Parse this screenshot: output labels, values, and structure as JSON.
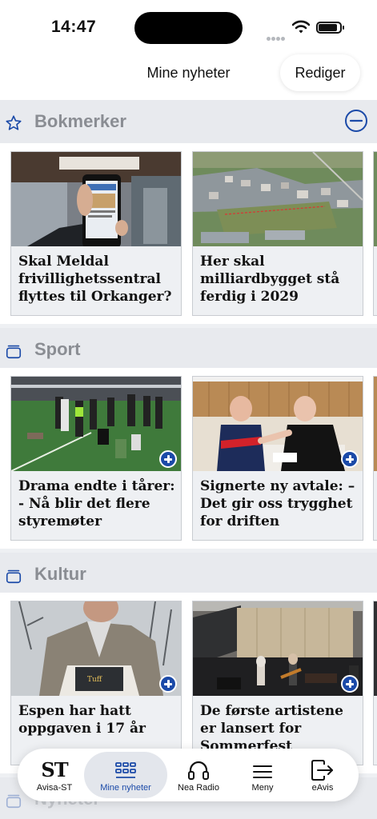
{
  "status_bar": {
    "time": "14:47"
  },
  "header": {
    "title": "Mine nyheter",
    "edit_label": "Rediger"
  },
  "sections": [
    {
      "title": "Bokmerker",
      "icon": "star-icon",
      "articles": [
        {
          "title": "Skal Meldal frivillighetssentral flyttes til Orkanger?",
          "image": "phone-in-hand-photo"
        },
        {
          "title": "Her skal milliardbygget stå ferdig i 2029",
          "image": "aerial-town-photo"
        }
      ]
    },
    {
      "title": "Sport",
      "icon": "stack-icon",
      "articles": [
        {
          "title": "Drama endte i tårer: - Nå blir det flere styremøter",
          "image": "football-team-photo"
        },
        {
          "title": "Signerte ny avtale: – Det gir oss trygghet for driften",
          "image": "arm-wrestling-photo"
        }
      ]
    },
    {
      "title": "Kultur",
      "icon": "stack-icon",
      "articles": [
        {
          "title": "Espen har hatt oppgaven  i 17 år",
          "image": "man-with-magazine-photo"
        },
        {
          "title": "De første artistene er lansert for Sommerfest",
          "image": "concert-stage-photo"
        }
      ]
    },
    {
      "title": "Nyheter",
      "icon": "stack-icon"
    }
  ],
  "tab_bar": [
    {
      "label": "Avisa-ST",
      "icon": "st-logo-icon",
      "active": false
    },
    {
      "label": "Mine nyheter",
      "icon": "grid-icon",
      "active": true
    },
    {
      "label": "Nea Radio",
      "icon": "headphones-icon",
      "active": false
    },
    {
      "label": "Meny",
      "icon": "menu-icon",
      "active": false
    },
    {
      "label": "eAvis",
      "icon": "exit-icon",
      "active": false
    }
  ],
  "tab_logo_text": "ST",
  "colors": {
    "accent": "#1b4aa8",
    "section_title": "#8a8d93",
    "background": "#eef0f3"
  }
}
